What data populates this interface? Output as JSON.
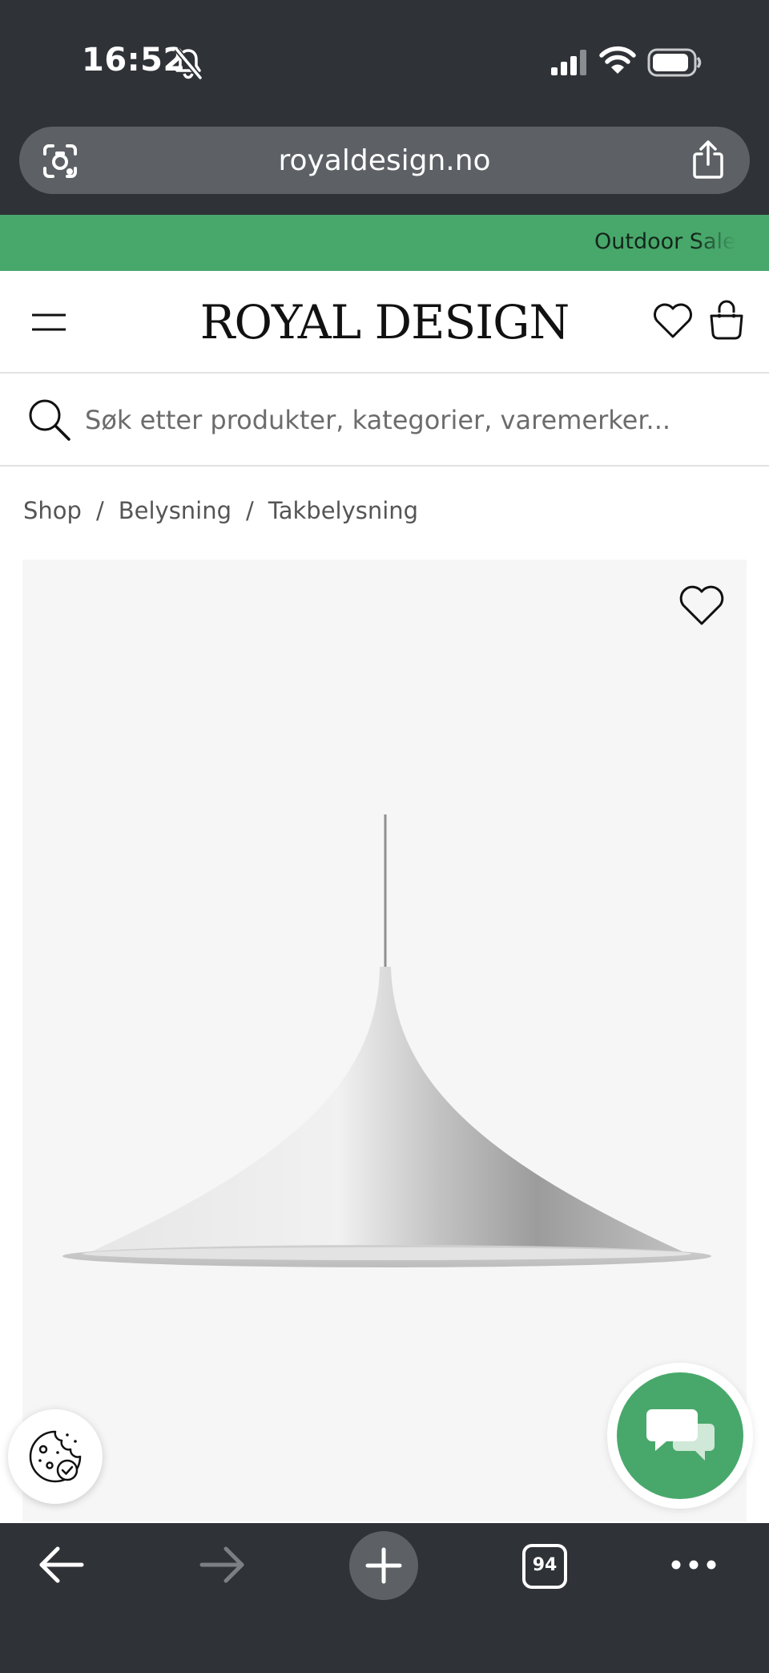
{
  "status_bar": {
    "time": "16:52"
  },
  "browser": {
    "url": "royaldesign.no",
    "tab_count": "94"
  },
  "promo": {
    "text": "Outdoor Sale"
  },
  "header": {
    "logo": "ROYAL DESIGN"
  },
  "search": {
    "placeholder": "Søk etter produkter, kategorier, varemerker..."
  },
  "breadcrumb": {
    "items": [
      "Shop",
      "Belysning",
      "Takbelysning"
    ],
    "separator": "/"
  },
  "colors": {
    "brand_green": "#48a86b",
    "browser_chrome": "#2f3236",
    "image_bg": "#f6f6f6"
  },
  "icons": [
    "lens-icon",
    "share-icon",
    "menu-icon",
    "wishlist-icon",
    "bag-icon",
    "search-icon",
    "heart-icon",
    "cookie-icon",
    "chat-icon",
    "back-icon",
    "forward-icon",
    "plus-icon",
    "more-icon"
  ]
}
